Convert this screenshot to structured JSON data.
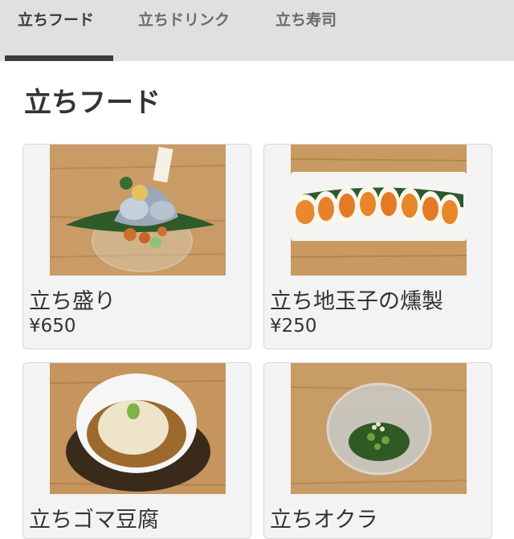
{
  "tabs": [
    {
      "label": "立ちフード",
      "active": true
    },
    {
      "label": "立ちドリンク",
      "active": false
    },
    {
      "label": "立ち寿司",
      "active": false
    }
  ],
  "section": {
    "title": "立ちフード"
  },
  "menu_items": [
    {
      "name": "立ち盛り",
      "price": "¥650",
      "image": "sashimi-plate-photo"
    },
    {
      "name": "立ち地玉子の燻製",
      "price": "¥250",
      "image": "smoked-eggs-photo"
    },
    {
      "name": "立ちゴマ豆腐",
      "price": "",
      "image": "sesame-tofu-photo"
    },
    {
      "name": "立ちオクラ",
      "price": "",
      "image": "okra-bowl-photo"
    }
  ],
  "colors": {
    "tabbar_bg": "#e0e0e0",
    "indicator": "#3d3d3d",
    "card_bg": "#f3f3f3",
    "wood": "#c89a63"
  }
}
